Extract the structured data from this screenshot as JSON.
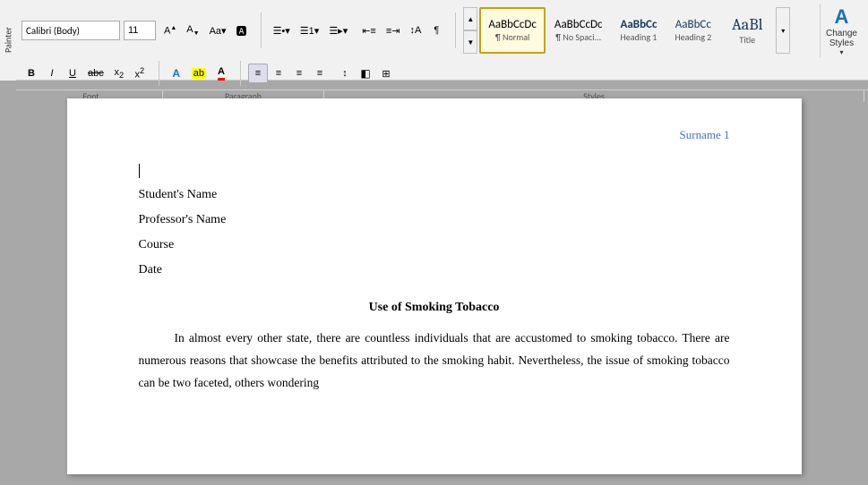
{
  "toolbar": {
    "font_family": "Calibri (Body)",
    "font_size": "11",
    "row1_btns": [
      "A↑",
      "A↓",
      "Aa▾",
      "🅰"
    ],
    "bullets_btn": "≡•",
    "numbering_btn": "≡1",
    "multilevel_btn": "≡▸",
    "indent_decrease": "←≡",
    "indent_increase": "≡→",
    "sort_btn": "↕A",
    "show_para_btn": "¶",
    "align_left": "≡L",
    "align_center": "≡C",
    "align_right": "≡R",
    "justify": "≡J",
    "line_spacing": "↕",
    "shading": "🖊",
    "borders": "□",
    "row2_bold": "B",
    "row2_italic": "I",
    "row2_underline": "U",
    "row2_strikethrough": "abc",
    "row2_sub": "x₂",
    "row2_sup": "x²",
    "row2_texteffects": "A",
    "row2_highlight": "ab",
    "row2_fontcolor": "A",
    "painter_label": "Painter",
    "styles": [
      {
        "id": "normal",
        "preview": "AaBbCcDc",
        "label": "¶ Normal",
        "active": true
      },
      {
        "id": "no-spacing",
        "preview": "AaBbCcDc",
        "label": "¶ No Spaci...",
        "active": false
      },
      {
        "id": "heading1",
        "preview": "AaBbCc",
        "label": "Heading 1",
        "active": false
      },
      {
        "id": "heading2",
        "preview": "AaBbCc",
        "label": "Heading 2",
        "active": false
      },
      {
        "id": "title",
        "preview": "AaBl",
        "label": "Title",
        "active": false
      }
    ],
    "change_styles_label": "Change\nStyles",
    "change_styles_icon": "A",
    "sections": {
      "font_label": "Font",
      "paragraph_label": "Paragraph",
      "styles_label": "Styles"
    }
  },
  "document": {
    "header_right": "Surname 1",
    "line1": "Student's Name",
    "line2": "Professor's Name",
    "line3": "Course",
    "line4": "Date",
    "title": "Use of Smoking Tobacco",
    "paragraph1": "In almost every other state, there are countless individuals that are accustomed to smoking tobacco. There are numerous reasons that showcase the benefits attributed to the smoking habit. Nevertheless, the issue of smoking tobacco can be two faceted, others wondering"
  }
}
